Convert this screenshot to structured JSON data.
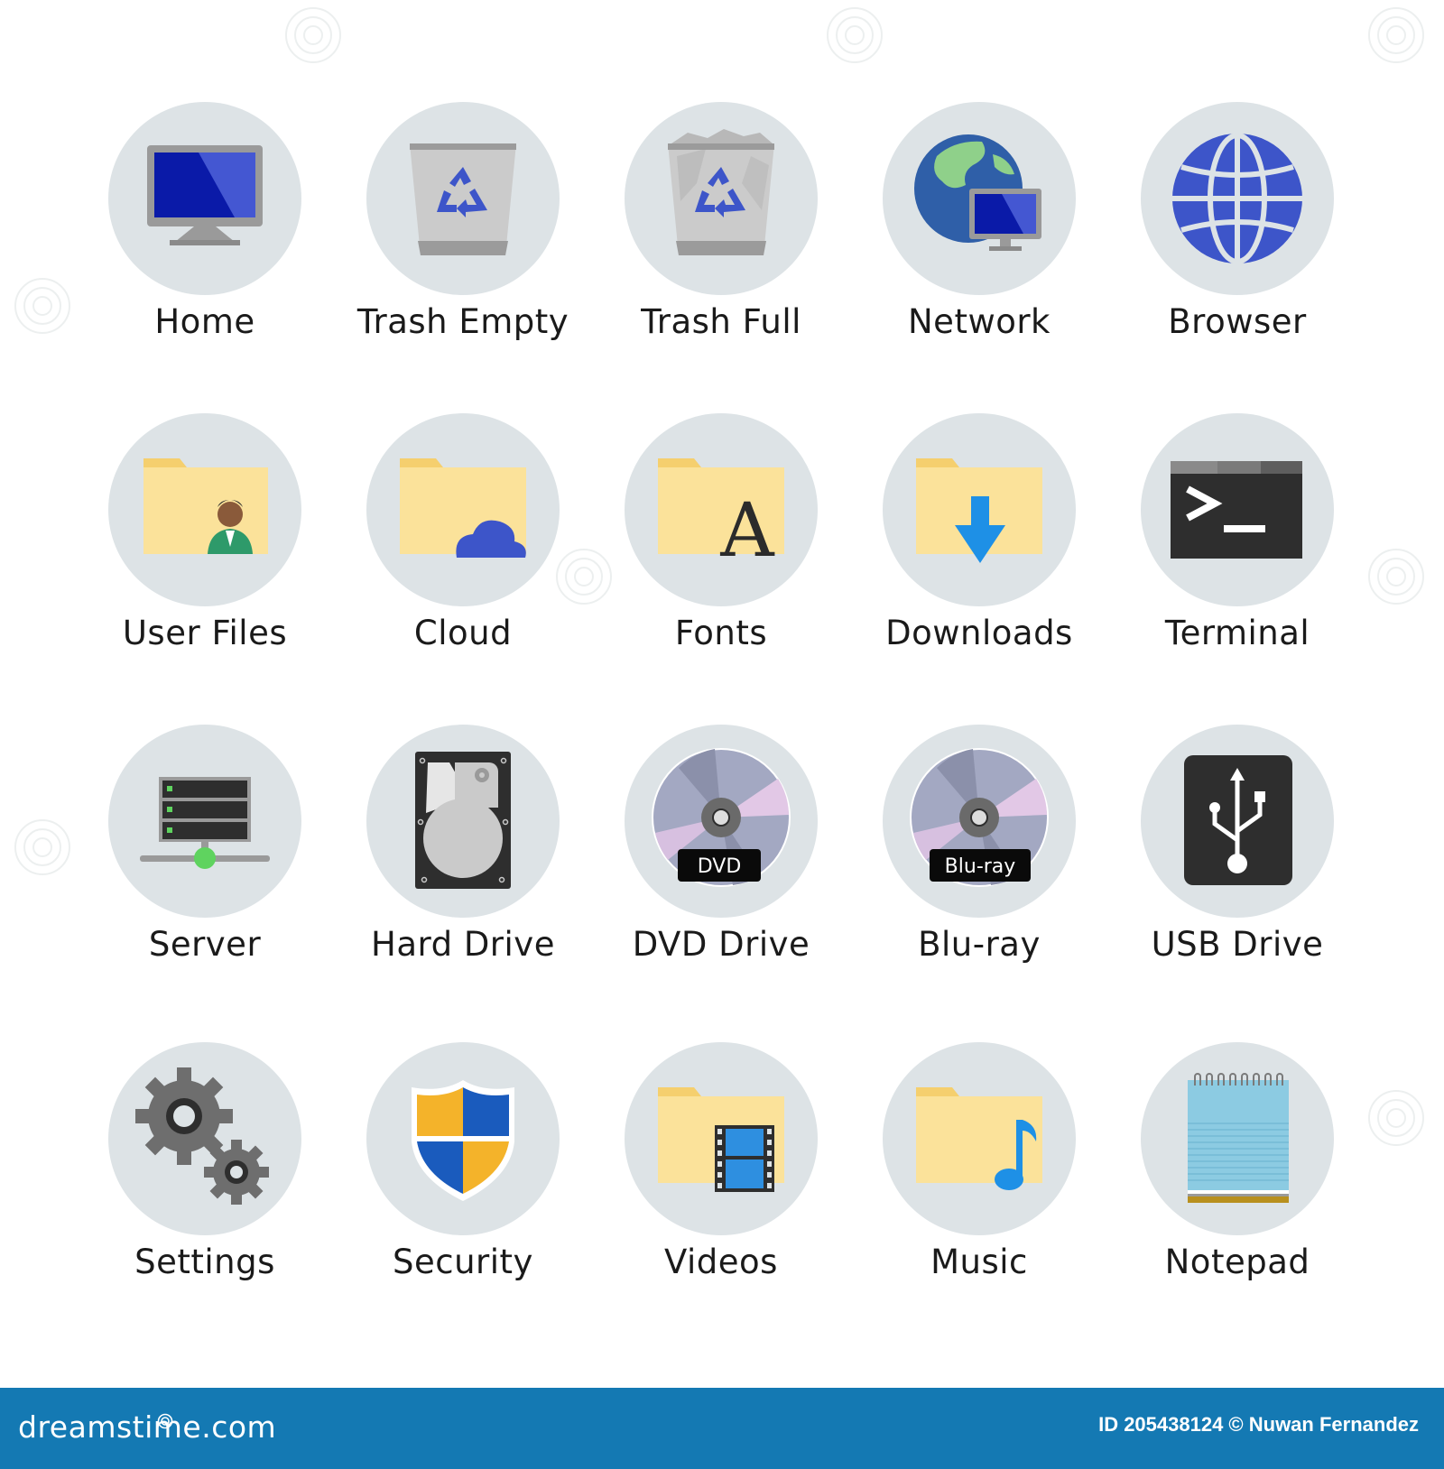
{
  "icons": [
    {
      "id": "home",
      "label": "Home",
      "icon": "monitor-icon"
    },
    {
      "id": "trash-empty",
      "label": "Trash Empty",
      "icon": "recycle-bin-empty-icon"
    },
    {
      "id": "trash-full",
      "label": "Trash Full",
      "icon": "recycle-bin-full-icon"
    },
    {
      "id": "network",
      "label": "Network",
      "icon": "globe-monitor-icon"
    },
    {
      "id": "browser",
      "label": "Browser",
      "icon": "globe-icon"
    },
    {
      "id": "user-files",
      "label": "User Files",
      "icon": "user-folder-icon"
    },
    {
      "id": "cloud",
      "label": "Cloud",
      "icon": "cloud-folder-icon"
    },
    {
      "id": "fonts",
      "label": "Fonts",
      "icon": "font-folder-icon"
    },
    {
      "id": "downloads",
      "label": "Downloads",
      "icon": "download-folder-icon"
    },
    {
      "id": "terminal",
      "label": "Terminal",
      "icon": "terminal-icon"
    },
    {
      "id": "server",
      "label": "Server",
      "icon": "server-icon"
    },
    {
      "id": "hard-drive",
      "label": "Hard Drive",
      "icon": "hard-drive-icon"
    },
    {
      "id": "dvd-drive",
      "label": "DVD Drive",
      "icon": "dvd-disc-icon",
      "badge": "DVD"
    },
    {
      "id": "blu-ray",
      "label": "Blu-ray",
      "icon": "bluray-disc-icon",
      "badge": "Blu-ray"
    },
    {
      "id": "usb-drive",
      "label": "USB Drive",
      "icon": "usb-icon"
    },
    {
      "id": "settings",
      "label": "Settings",
      "icon": "gears-icon"
    },
    {
      "id": "security",
      "label": "Security",
      "icon": "shield-icon"
    },
    {
      "id": "videos",
      "label": "Videos",
      "icon": "video-folder-icon"
    },
    {
      "id": "music",
      "label": "Music",
      "icon": "music-folder-icon"
    },
    {
      "id": "notepad",
      "label": "Notepad",
      "icon": "notepad-icon"
    }
  ],
  "terminal_prompt": ">_",
  "colors": {
    "disk": "#dde3e6",
    "footer": "#1479b3",
    "folder": "#fbe29a",
    "folder_tab": "#f5cf6e",
    "accent_blue": "#3d55c9",
    "screen_dark": "#0a1aa8",
    "download_blue": "#1e90e6",
    "server_green": "#5fd35f"
  },
  "footer": {
    "brand": "dreamstime.com",
    "credit": "ID 205438124 © Nuwan Fernandez"
  }
}
